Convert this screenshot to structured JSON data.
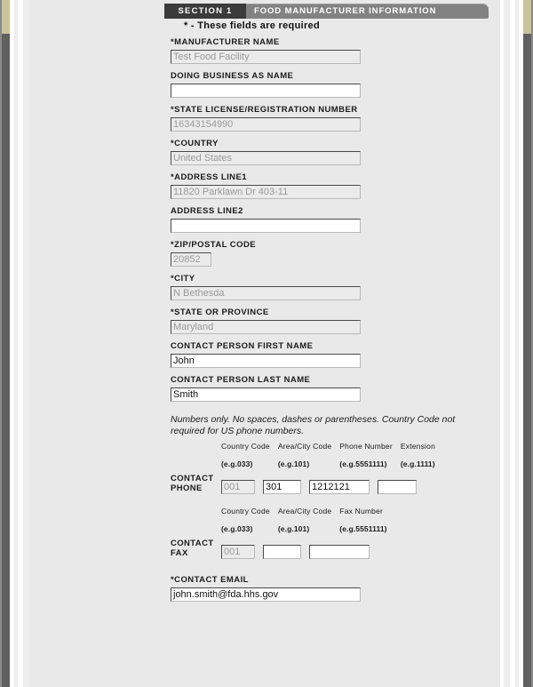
{
  "section": {
    "number_label": "SECTION 1",
    "title": "FOOD MANUFACTURER INFORMATION",
    "required_note": "* - These fields are required"
  },
  "colors": {
    "section_number_bg": "#3b3b3b",
    "section_title_bg": "#828282",
    "panel_bg": "#e9e9e9",
    "readonly_field_bg": "#ebebeb",
    "readonly_field_text": "#9a9a9a",
    "editable_field_bg": "#ffffff",
    "editable_field_text": "#111111",
    "gutter_khaki": "#c9c49a",
    "gutter_dark": "#606060"
  },
  "fields": {
    "manufacturer_name": {
      "label": "*MANUFACTURER NAME",
      "value": "Test Food Facility",
      "placeholder": "",
      "readonly": true
    },
    "doing_business_as": {
      "label": "DOING BUSINESS AS NAME",
      "value": "",
      "placeholder": "",
      "readonly": false
    },
    "state_license": {
      "label": "*STATE LICENSE/REGISTRATION NUMBER",
      "value": "16343154990",
      "placeholder": "",
      "readonly": true
    },
    "country": {
      "label": "*COUNTRY",
      "value": "United States",
      "placeholder": "",
      "readonly": true
    },
    "address_line1": {
      "label": "*ADDRESS LINE1",
      "value": "11820 Parklawn Dr 403-11",
      "placeholder": "",
      "readonly": true
    },
    "address_line2": {
      "label": "ADDRESS LINE2",
      "value": "",
      "placeholder": "",
      "readonly": false
    },
    "zip_postal_code": {
      "label": "*ZIP/POSTAL CODE",
      "value": "20852",
      "placeholder": "",
      "readonly": true
    },
    "city": {
      "label": "*CITY",
      "value": "N Bethesda",
      "placeholder": "",
      "readonly": true
    },
    "state_or_province": {
      "label": "*STATE OR PROVINCE",
      "value": "Maryland",
      "placeholder": "",
      "readonly": true
    },
    "contact_first_name": {
      "label": "CONTACT PERSON FIRST NAME",
      "value": "John",
      "placeholder": "",
      "readonly": false
    },
    "contact_last_name": {
      "label": "CONTACT PERSON LAST NAME",
      "value": "Smith",
      "placeholder": "",
      "readonly": false
    },
    "contact_email": {
      "label": "*CONTACT EMAIL",
      "value": "john.smith@fda.hhs.gov",
      "placeholder": "",
      "readonly": false
    }
  },
  "phone_note": "Numbers only. No spaces, dashes or parentheses. Country Code not required for US phone numbers.",
  "contact_phone": {
    "row_label": "CONTACT PHONE",
    "columns": [
      {
        "header": "Country Code",
        "example": "(e.g.033)",
        "value": "001",
        "readonly": true
      },
      {
        "header": "Area/City Code",
        "example": "(e.g.101)",
        "value": "301",
        "readonly": false
      },
      {
        "header": "Phone Number",
        "example": "(e.g.5551111)",
        "value": "1212121",
        "readonly": false
      },
      {
        "header": "Extension",
        "example": "(e.g.1111)",
        "value": "",
        "readonly": false
      }
    ]
  },
  "contact_fax": {
    "row_label": "CONTACT FAX",
    "columns": [
      {
        "header": "Country Code",
        "example": "(e.g.033)",
        "value": "001",
        "readonly": true
      },
      {
        "header": "Area/City Code",
        "example": "(e.g.101)",
        "value": "",
        "readonly": false
      },
      {
        "header": "Fax Number",
        "example": "(e.g.5551111)",
        "value": "",
        "readonly": false
      }
    ]
  }
}
